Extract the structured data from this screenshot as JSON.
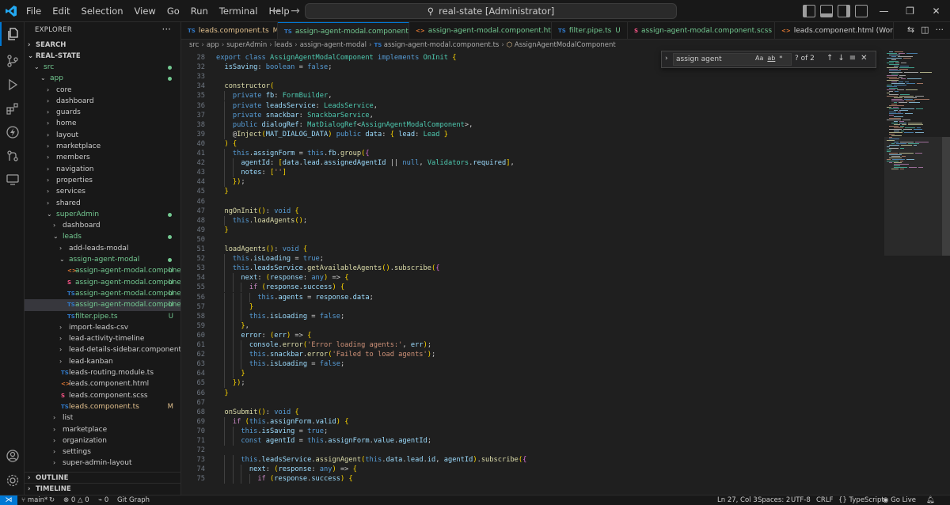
{
  "menu": [
    "File",
    "Edit",
    "Selection",
    "View",
    "Go",
    "Run",
    "Terminal",
    "Help"
  ],
  "command_center": "real-state [Administrator]",
  "explorer": {
    "title": "EXPLORER",
    "sections": {
      "search": "SEARCH",
      "root": "REAL-STATE",
      "outline": "OUTLINE",
      "timeline": "TIMELINE"
    },
    "tree": [
      {
        "label": "src",
        "depth": 1,
        "folder": true,
        "open": true,
        "color": "green",
        "badge": "dot"
      },
      {
        "label": "app",
        "depth": 2,
        "folder": true,
        "open": true,
        "color": "green",
        "badge": "dot"
      },
      {
        "label": "core",
        "depth": 3,
        "folder": true
      },
      {
        "label": "dashboard",
        "depth": 3,
        "folder": true
      },
      {
        "label": "guards",
        "depth": 3,
        "folder": true
      },
      {
        "label": "home",
        "depth": 3,
        "folder": true
      },
      {
        "label": "layout",
        "depth": 3,
        "folder": true
      },
      {
        "label": "marketplace",
        "depth": 3,
        "folder": true
      },
      {
        "label": "members",
        "depth": 3,
        "folder": true
      },
      {
        "label": "navigation",
        "depth": 3,
        "folder": true
      },
      {
        "label": "properties",
        "depth": 3,
        "folder": true
      },
      {
        "label": "services",
        "depth": 3,
        "folder": true
      },
      {
        "label": "shared",
        "depth": 3,
        "folder": true
      },
      {
        "label": "superAdmin",
        "depth": 3,
        "folder": true,
        "open": true,
        "color": "green",
        "badge": "dot"
      },
      {
        "label": "dashboard",
        "depth": 4,
        "folder": true
      },
      {
        "label": "leads",
        "depth": 4,
        "folder": true,
        "open": true,
        "color": "green",
        "badge": "dot"
      },
      {
        "label": "add-leads-modal",
        "depth": 5,
        "folder": true
      },
      {
        "label": "assign-agent-modal",
        "depth": 5,
        "folder": true,
        "open": true,
        "color": "green",
        "badge": "dot"
      },
      {
        "label": "assign-agent-modal.component....",
        "depth": 6,
        "icon": "html",
        "color": "green",
        "badge": "U"
      },
      {
        "label": "assign-agent-modal.component....",
        "depth": 6,
        "icon": "scss",
        "color": "green",
        "badge": "U"
      },
      {
        "label": "assign-agent-modal.component....",
        "depth": 6,
        "icon": "ts",
        "color": "green",
        "badge": "U"
      },
      {
        "label": "assign-agent-modal.component.ts",
        "depth": 6,
        "icon": "ts",
        "color": "green",
        "badge": "U",
        "selected": true
      },
      {
        "label": "filter.pipe.ts",
        "depth": 6,
        "icon": "ts",
        "color": "green",
        "badge": "U"
      },
      {
        "label": "import-leads-csv",
        "depth": 5,
        "folder": true
      },
      {
        "label": "lead-activity-timeline",
        "depth": 5,
        "folder": true
      },
      {
        "label": "lead-details-sidebar.component.ts",
        "depth": 5,
        "folder": true
      },
      {
        "label": "lead-kanban",
        "depth": 5,
        "folder": true
      },
      {
        "label": "leads-routing.module.ts",
        "depth": 5,
        "icon": "ts"
      },
      {
        "label": "leads.component.html",
        "depth": 5,
        "icon": "html"
      },
      {
        "label": "leads.component.scss",
        "depth": 5,
        "icon": "scss"
      },
      {
        "label": "leads.component.ts",
        "depth": 5,
        "icon": "ts",
        "color": "yellow",
        "badge": "M"
      },
      {
        "label": "list",
        "depth": 4,
        "folder": true
      },
      {
        "label": "marketplace",
        "depth": 4,
        "folder": true
      },
      {
        "label": "organization",
        "depth": 4,
        "folder": true
      },
      {
        "label": "settings",
        "depth": 4,
        "folder": true
      },
      {
        "label": "super-admin-layout",
        "depth": 4,
        "folder": true
      }
    ]
  },
  "tabs": [
    {
      "label": "leads.component.ts",
      "icon": "ts",
      "mark": "M",
      "color": "yellow"
    },
    {
      "label": "assign-agent-modal.component.ts",
      "icon": "ts",
      "mark": "U",
      "color": "green",
      "active": true
    },
    {
      "label": "assign-agent-modal.component.html",
      "icon": "html",
      "mark": "U",
      "color": "green"
    },
    {
      "label": "filter.pipe.ts",
      "icon": "ts",
      "mark": "U",
      "color": "green"
    },
    {
      "label": "assign-agent-modal.component.scss",
      "icon": "scss",
      "mark": "U",
      "color": "green"
    },
    {
      "label": "leads.component.html (Working Tr",
      "icon": "html",
      "mark": "",
      "color": "plain"
    }
  ],
  "breadcrumb": [
    "src",
    "app",
    "superAdmin",
    "leads",
    "assign-agent-modal",
    "assign-agent-modal.component.ts",
    "AssignAgentModalComponent"
  ],
  "find_widget": {
    "query": "assign agent",
    "options": [
      "Aa",
      "ab",
      "*"
    ],
    "count": "? of 2"
  },
  "code_lines": [
    {
      "n": "28",
      "t": "export class AssignAgentModalComponent implements OnInit {"
    },
    {
      "n": "32",
      "t": "  isSaving: boolean = false;"
    },
    {
      "n": "33",
      "t": ""
    },
    {
      "n": "34",
      "t": "  constructor("
    },
    {
      "n": "35",
      "t": "    private fb: FormBuilder,"
    },
    {
      "n": "36",
      "t": "    private leadsService: LeadsService,"
    },
    {
      "n": "37",
      "t": "    private snackbar: SnackbarService,"
    },
    {
      "n": "38",
      "t": "    public dialogRef: MatDialogRef<AssignAgentModalComponent>,"
    },
    {
      "n": "39",
      "t": "    @Inject(MAT_DIALOG_DATA) public data: { lead: Lead }"
    },
    {
      "n": "40",
      "t": "  ) {"
    },
    {
      "n": "41",
      "t": "    this.assignForm = this.fb.group({"
    },
    {
      "n": "42",
      "t": "      agentId: [data.lead.assignedAgentId || null, Validators.required],"
    },
    {
      "n": "43",
      "t": "      notes: ['']"
    },
    {
      "n": "44",
      "t": "    });"
    },
    {
      "n": "45",
      "t": "  }"
    },
    {
      "n": "46",
      "t": ""
    },
    {
      "n": "47",
      "t": "  ngOnInit(): void {"
    },
    {
      "n": "48",
      "t": "    this.loadAgents();"
    },
    {
      "n": "49",
      "t": "  }"
    },
    {
      "n": "50",
      "t": ""
    },
    {
      "n": "51",
      "t": "  loadAgents(): void {"
    },
    {
      "n": "52",
      "t": "    this.isLoading = true;"
    },
    {
      "n": "53",
      "t": "    this.leadsService.getAvailableAgents().subscribe({"
    },
    {
      "n": "54",
      "t": "      next: (response: any) => {"
    },
    {
      "n": "55",
      "t": "        if (response.success) {"
    },
    {
      "n": "56",
      "t": "          this.agents = response.data;"
    },
    {
      "n": "57",
      "t": "        }"
    },
    {
      "n": "58",
      "t": "        this.isLoading = false;"
    },
    {
      "n": "59",
      "t": "      },"
    },
    {
      "n": "60",
      "t": "      error: (err) => {"
    },
    {
      "n": "61",
      "t": "        console.error('Error loading agents:', err);"
    },
    {
      "n": "62",
      "t": "        this.snackbar.error('Failed to load agents');"
    },
    {
      "n": "63",
      "t": "        this.isLoading = false;"
    },
    {
      "n": "64",
      "t": "      }"
    },
    {
      "n": "65",
      "t": "    });"
    },
    {
      "n": "66",
      "t": "  }"
    },
    {
      "n": "67",
      "t": ""
    },
    {
      "n": "68",
      "t": "  onSubmit(): void {"
    },
    {
      "n": "69",
      "t": "    if (this.assignForm.valid) {"
    },
    {
      "n": "70",
      "t": "      this.isSaving = true;"
    },
    {
      "n": "71",
      "t": "      const agentId = this.assignForm.value.agentId;"
    },
    {
      "n": "72",
      "t": ""
    },
    {
      "n": "73",
      "t": "      this.leadsService.assignAgent(this.data.lead.id, agentId).subscribe({"
    },
    {
      "n": "74",
      "t": "        next: (response: any) => {"
    },
    {
      "n": "75",
      "t": "          if (response.success) {"
    }
  ],
  "statusbar": {
    "branch": "main*",
    "errors": "0",
    "warnings": "0",
    "ports": "0",
    "git_graph": "Git Graph",
    "position": "Ln 27, Col 3",
    "spaces": "Spaces: 2",
    "encoding": "UTF-8",
    "eol": "CRLF",
    "language": "TypeScript",
    "live": "Go Live"
  },
  "colors": {
    "accent": "#0078d4",
    "untracked": "#73c991",
    "modified": "#e2c08d",
    "ts": "#3178c6",
    "html": "#e37933",
    "scss": "#f55385"
  }
}
